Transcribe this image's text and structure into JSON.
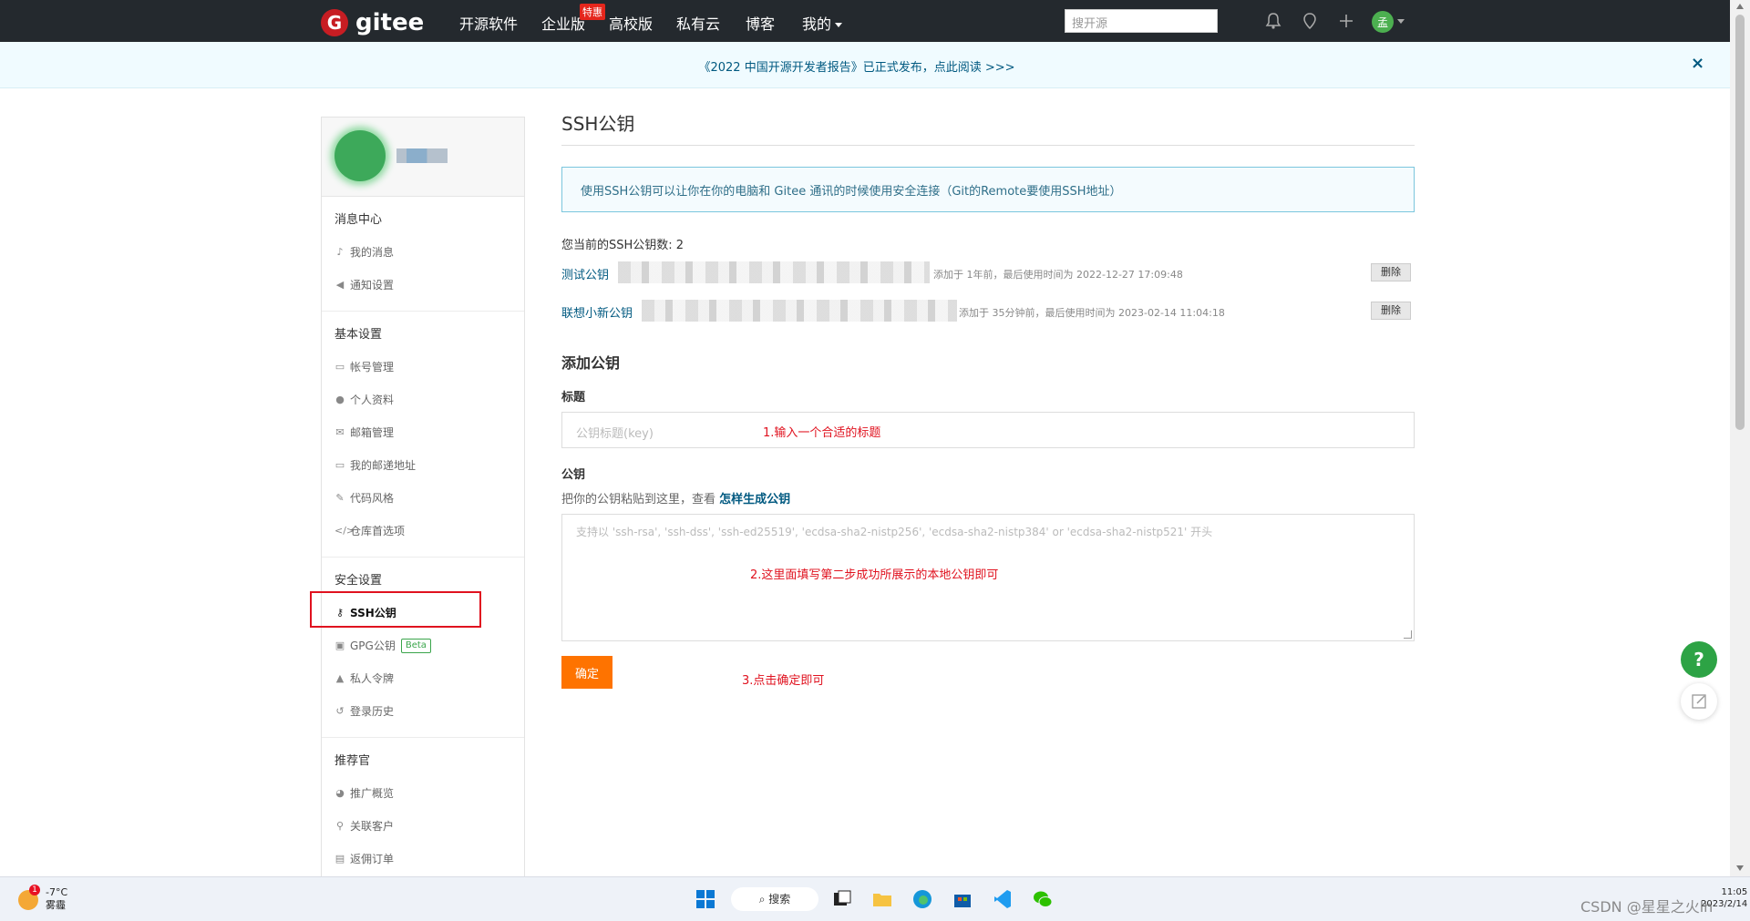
{
  "topnav": {
    "logo_mark": "G",
    "logo_text": "gitee",
    "items": [
      "开源软件",
      "企业版",
      "高校版",
      "私有云",
      "博客",
      "我的"
    ],
    "badge": "特惠",
    "search_placeholder": "搜开源",
    "avatar_text": "孟"
  },
  "banner": {
    "text": "《2022 中国开源开发者报告》已正式发布，点此阅读 >>>",
    "close": "×"
  },
  "sidebar": {
    "sections": [
      {
        "title": "消息中心",
        "items": [
          {
            "icon": "bell-icon",
            "glyph": "♪",
            "label": "我的消息"
          },
          {
            "icon": "speaker-icon",
            "glyph": "◀",
            "label": "通知设置"
          }
        ]
      },
      {
        "title": "基本设置",
        "items": [
          {
            "icon": "id-card-icon",
            "glyph": "▭",
            "label": "帐号管理"
          },
          {
            "icon": "user-icon",
            "glyph": "●",
            "label": "个人资料"
          },
          {
            "icon": "mail-icon",
            "glyph": "✉",
            "label": "邮箱管理"
          },
          {
            "icon": "address-card-icon",
            "glyph": "▭",
            "label": "我的邮递地址"
          },
          {
            "icon": "brush-icon",
            "glyph": "✎",
            "label": "代码风格"
          },
          {
            "icon": "code-icon",
            "glyph": "</>",
            "label": "仓库首选项"
          }
        ]
      },
      {
        "title": "安全设置",
        "items": [
          {
            "icon": "key-icon",
            "glyph": "⚷",
            "label": "SSH公钥"
          },
          {
            "icon": "lock-icon",
            "glyph": "▣",
            "label": "GPG公钥",
            "badge": "Beta"
          },
          {
            "icon": "token-icon",
            "glyph": "▲",
            "label": "私人令牌"
          },
          {
            "icon": "history-icon",
            "glyph": "↺",
            "label": "登录历史"
          }
        ]
      },
      {
        "title": "推荐官",
        "items": [
          {
            "icon": "chart-icon",
            "glyph": "◕",
            "label": "推广概览"
          },
          {
            "icon": "customers-icon",
            "glyph": "⚲",
            "label": "关联客户"
          },
          {
            "icon": "orders-icon",
            "glyph": "▤",
            "label": "返佣订单"
          }
        ]
      }
    ]
  },
  "main": {
    "title": "SSH公钥",
    "info": "使用SSH公钥可以让你在你的电脑和 Gitee 通讯的时候使用安全连接（Git的Remote要使用SSH地址）",
    "count_label": "您当前的SSH公钥数: 2",
    "keys": [
      {
        "name": "测试公钥",
        "meta": "添加于 1年前，最后使用时间为 2022-12-27 17:09:48",
        "delete": "删除"
      },
      {
        "name": "联想小新公钥",
        "meta": "添加于 35分钟前，最后使用时间为 2023-02-14 11:04:18",
        "delete": "删除"
      }
    ],
    "add_title": "添加公钥",
    "title_label": "标题",
    "title_placeholder": "公钥标题(key)",
    "pubkey_label": "公钥",
    "pubkey_help": "把你的公钥粘贴到这里，查看 ",
    "pubkey_help_link": "怎样生成公钥",
    "pubkey_placeholder": "支持以 'ssh-rsa', 'ssh-dss', 'ssh-ed25519', 'ecdsa-sha2-nistp256', 'ecdsa-sha2-nistp384' or 'ecdsa-sha2-nistp521' 开头",
    "confirm": "确定"
  },
  "annotations": {
    "a1": "1.输入一个合适的标题",
    "a2": "2.这里面填写第二步成功所展示的本地公钥即可",
    "a3": "3.点击确定即可"
  },
  "float_help": "?",
  "taskbar": {
    "weather_badge": "1",
    "temp": "-7°C",
    "weather": "雾霾",
    "search": "搜索",
    "time": "11:05",
    "date": "2023/2/14"
  },
  "watermark": "CSDN @星星之火lh",
  "colors": {
    "nav_bg": "#24292e",
    "link": "#005980",
    "accent_orange": "#fe7300",
    "annotation_red": "#e0121f",
    "brand_red": "#c71d23"
  }
}
